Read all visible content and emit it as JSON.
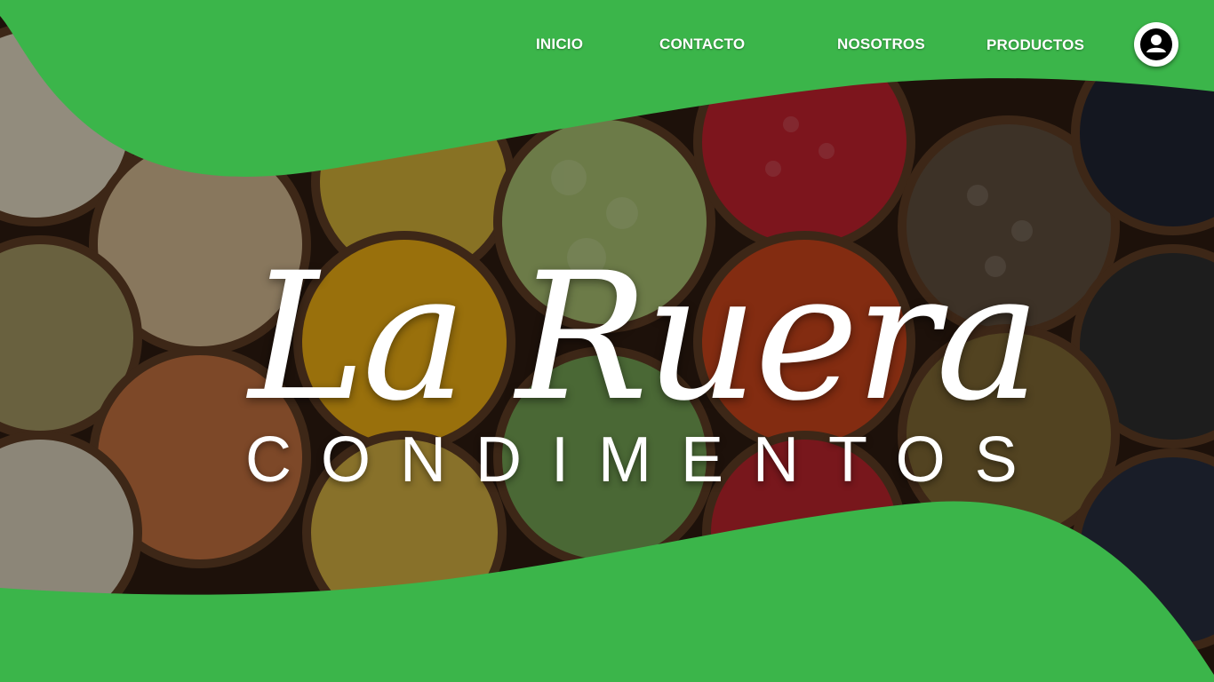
{
  "nav": {
    "items": [
      {
        "label": "INICIO"
      },
      {
        "label": "CONTACTO"
      },
      {
        "label": "NOSOTROS"
      },
      {
        "label": "PRODUCTOS"
      }
    ],
    "profile_icon": "user-circle-icon"
  },
  "hero": {
    "brand_name": "La Ruera",
    "brand_subtitle": "CONDIMENTOS",
    "background": "spice-bowls-photo"
  },
  "colors": {
    "brand_green": "#3bb54a",
    "text": "#ffffff"
  }
}
